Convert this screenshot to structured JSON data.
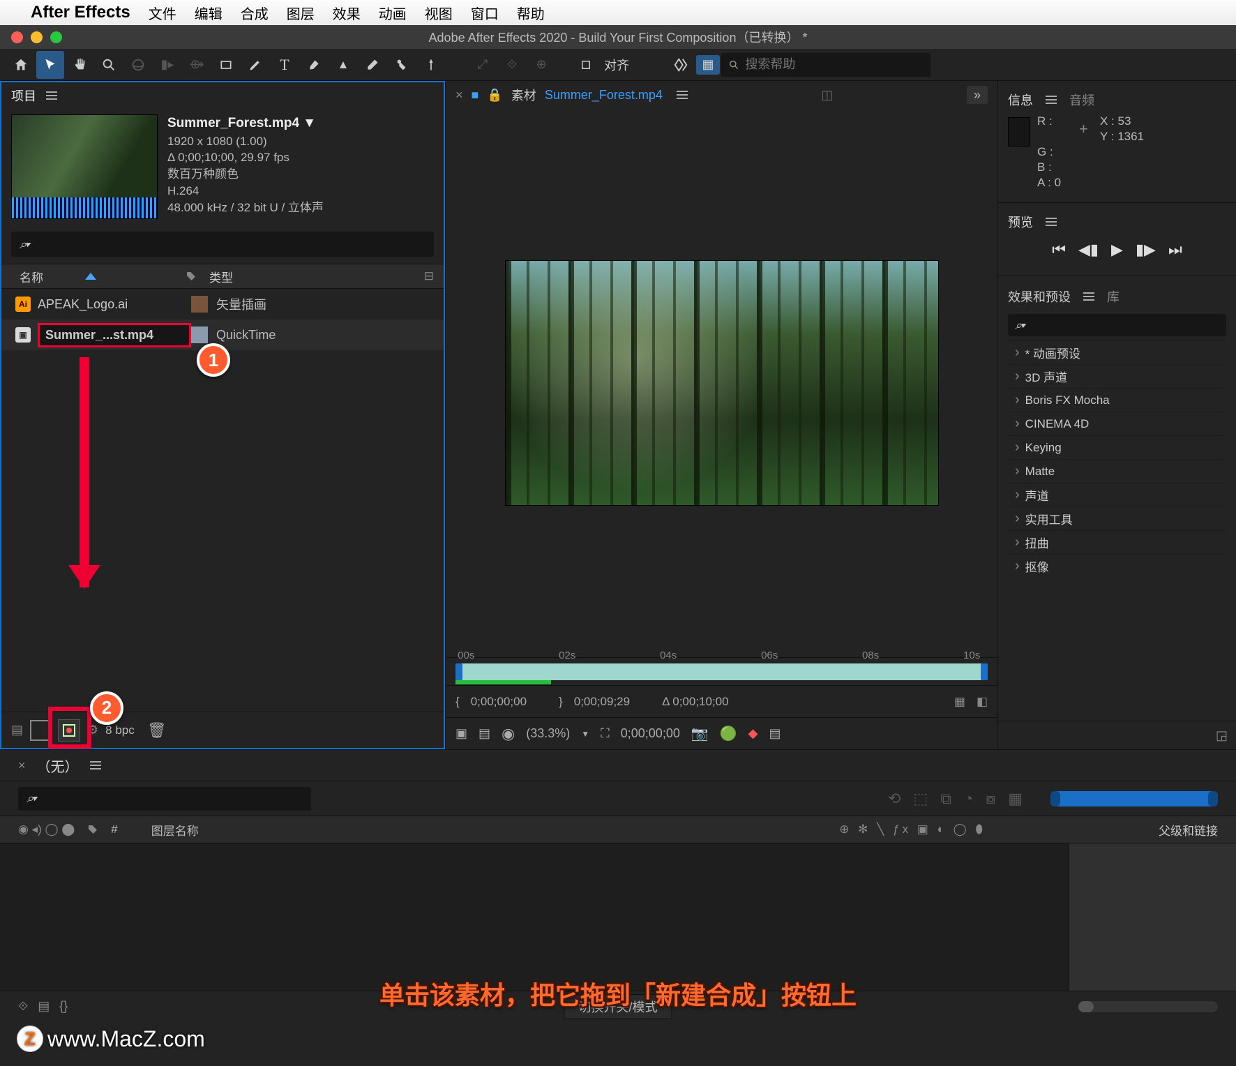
{
  "menubar": {
    "app": "After Effects",
    "items": [
      "文件",
      "编辑",
      "合成",
      "图层",
      "效果",
      "动画",
      "视图",
      "窗口",
      "帮助"
    ]
  },
  "window": {
    "title": "Adobe After Effects 2020 - Build Your First Composition（已转换） *"
  },
  "toolbar": {
    "align_label": "对齐",
    "search_placeholder": "搜索帮助"
  },
  "project": {
    "tab": "项目",
    "asset": {
      "name": "Summer_Forest.mp4 ▼",
      "dims": "1920 x 1080 (1.00)",
      "dur": "Δ 0;00;10;00, 29.97 fps",
      "colors": "数百万种颜色",
      "codec": "H.264",
      "audio": "48.000 kHz / 32 bit U / 立体声"
    },
    "search_placeholder": "⌕▾",
    "cols": {
      "name": "名称",
      "type": "类型"
    },
    "rows": [
      {
        "file": "APEAK_Logo.ai",
        "type": "矢量插画",
        "kind": "ai"
      },
      {
        "file": "Summer_...st.mp4",
        "type": "QuickTime",
        "kind": "mov"
      }
    ],
    "bpc": "8 bpc"
  },
  "viewer": {
    "footage_label": "素材",
    "footage_name": "Summer_Forest.mp4",
    "ticks": [
      "00s",
      "02s",
      "04s",
      "06s",
      "08s",
      "10s"
    ],
    "tc_in": "0;00;00;00",
    "tc_out": "0;00;09;29",
    "tc_dur": "Δ 0;00;10;00",
    "zoom": "(33.3%)",
    "tc_main": "0;00;00;00"
  },
  "info": {
    "tab1": "信息",
    "tab2": "音频",
    "r": "R :",
    "g": "G :",
    "b": "B :",
    "a": "A :  0",
    "x": "X : 53",
    "y": "Y : 1361"
  },
  "preview": {
    "tab": "预览"
  },
  "effects": {
    "tab1": "效果和预设",
    "tab2": "库",
    "items": [
      "* 动画预设",
      "3D 声道",
      "Boris FX Mocha",
      "CINEMA 4D",
      "Keying",
      "Matte",
      "声道",
      "实用工具",
      "扭曲",
      "抠像"
    ]
  },
  "timeline": {
    "none": "（无）",
    "layer_col": "图层名称",
    "parent_col": "父级和链接",
    "switch_label": "切换开关/模式"
  },
  "annotation": "单击该素材，把它拖到「新建合成」按钮上",
  "watermark": "www.MacZ.com",
  "badges": {
    "one": "1",
    "two": "2"
  }
}
